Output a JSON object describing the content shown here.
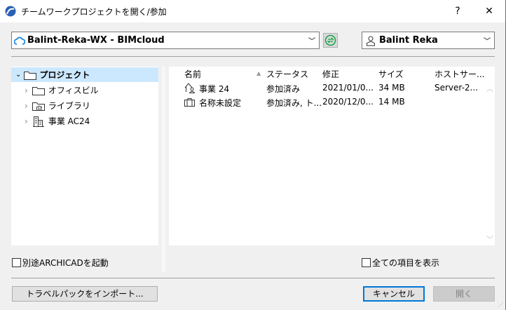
{
  "window": {
    "title": "チームワークプロジェクトを開く/参加",
    "help": "?",
    "close": "✕"
  },
  "server": {
    "value": "Balint-Reka-WX - BIMcloud"
  },
  "user": {
    "value": "Balint Reka"
  },
  "tree": [
    {
      "label": "プロジェクト",
      "expanded": true,
      "selected": true
    },
    {
      "label": "オフィスビル"
    },
    {
      "label": "ライブラリ"
    },
    {
      "label": "事業 AC24"
    }
  ],
  "table": {
    "columns": [
      "名前",
      "ステータス",
      "修正",
      "サイズ",
      "ホストサー..."
    ],
    "rows": [
      {
        "name": "事業 24",
        "status": "参加済み",
        "modified": "2021/01/0...",
        "size": "34 MB",
        "host": "Server-2..."
      },
      {
        "name": "名称未設定",
        "status": "参加済み, ト...",
        "modified": "2020/12/0...",
        "size": "14 MB",
        "host": ""
      }
    ]
  },
  "options": {
    "launch_separate": "別途ARCHICADを起動",
    "show_all": "全ての項目を表示"
  },
  "buttons": {
    "import": "トラベルパックをインポート...",
    "cancel": "キャンセル",
    "open": "開く"
  },
  "colors": {
    "accent": "#0078d7",
    "selection": "#cce8ff",
    "sync": "#1aa34a"
  }
}
